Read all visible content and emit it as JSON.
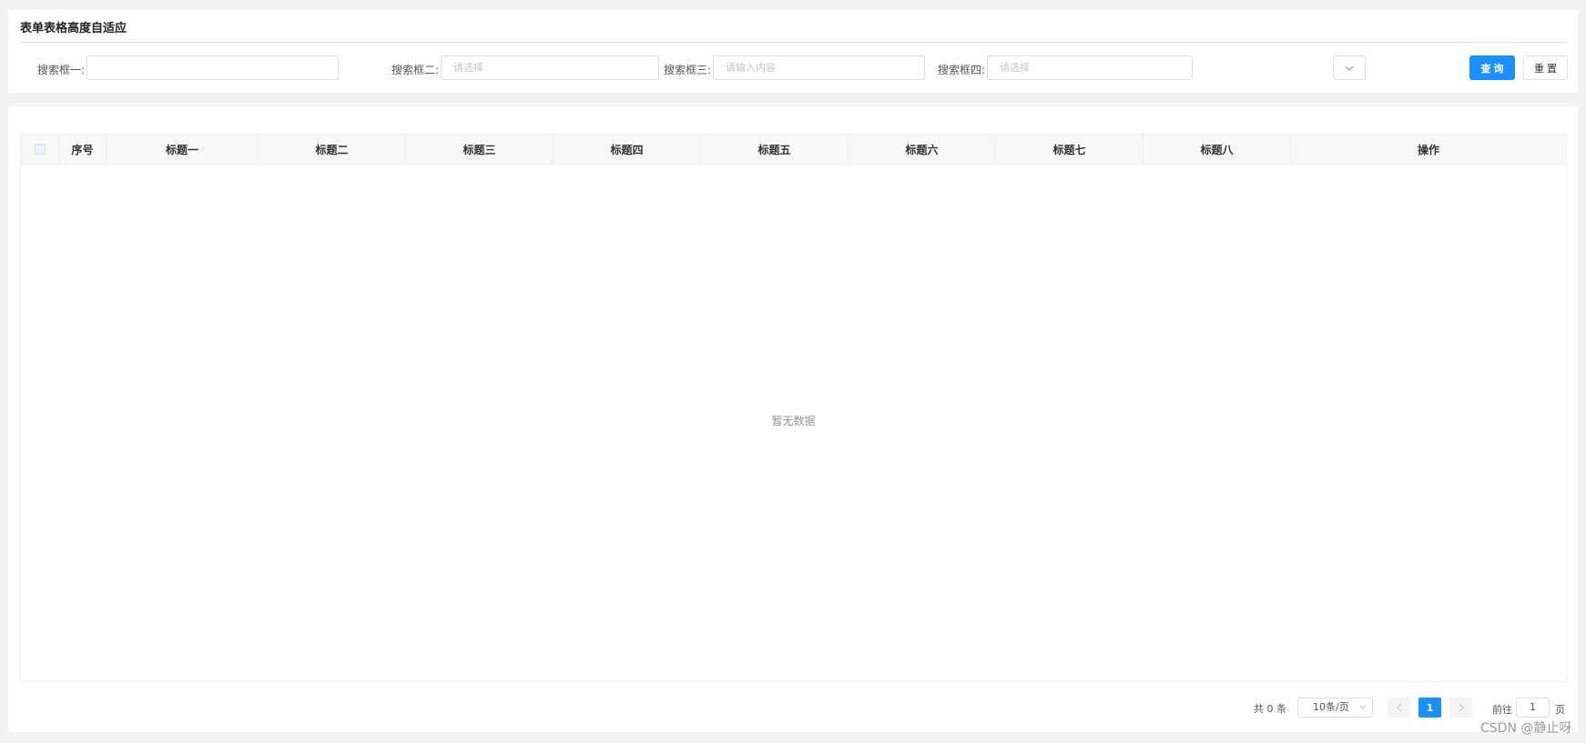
{
  "page": {
    "title": "表单表格高度自适应"
  },
  "search": {
    "field1": {
      "label": "搜索框一:",
      "value": "",
      "placeholder": ""
    },
    "field2": {
      "label": "搜索框二:",
      "placeholder": "请选择"
    },
    "field3": {
      "label": "搜索框三:",
      "placeholder": "请输入内容"
    },
    "field4": {
      "label": "搜索框四:",
      "placeholder": "请选择"
    },
    "query_label": "查询",
    "reset_label": "重置"
  },
  "table": {
    "columns": [
      "序号",
      "标题一",
      "标题二",
      "标题三",
      "标题四",
      "标题五",
      "标题六",
      "标题七",
      "标题八",
      "操作"
    ],
    "rows": [],
    "empty_text": "暂无数据"
  },
  "pagination": {
    "total_text": "共 0 条",
    "page_size": "10条/页",
    "current_page": "1",
    "goto_label": "前往",
    "goto_value": "1",
    "page_unit": "页"
  },
  "watermark": "CSDN @静止呀",
  "colors": {
    "primary": "#1890ff",
    "border": "#dcdfe6",
    "background": "#f3f3f3"
  },
  "icons": {
    "dropdown": "chevron-down-icon",
    "prev": "chevron-left-icon",
    "next": "chevron-right-icon"
  }
}
